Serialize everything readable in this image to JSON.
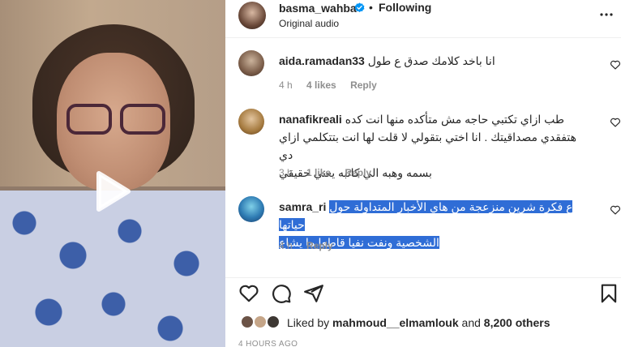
{
  "post": {
    "username": "basma_wahba",
    "separator": "•",
    "follow_label": "Following",
    "audio": "Original audio",
    "timestamp": "4 HOURS AGO"
  },
  "comments": [
    {
      "user": "aida.ramadan33",
      "text": "انا باخد كلامك صدق ع طول",
      "time": "4 h",
      "likes": "4 likes",
      "reply": "Reply"
    },
    {
      "user": "nanafikreali",
      "lines": [
        "طب ازاي تكتبي حاجه مش متأكده منها انت كده",
        "هتفقدي مصداقيتك . انا اختي بتقولي لا قلت لها انت بتتكلمي ازاي دي",
        "بسمه وهبه الي كاتبه يعني حقيقي"
      ],
      "time": "3 h",
      "likes": "1 like",
      "reply": "Reply"
    },
    {
      "user": "samra_ri",
      "lines": [
        "ع فكرة شرين منزعجة من هاي الأخبار المتداولة حول حياتها",
        "الشخصية ونفت نفيا قاطعا ما يشاع"
      ],
      "time": "4 h",
      "reply": "Reply"
    }
  ],
  "liked_by": {
    "prefix": "Liked by",
    "user": "mahmoud__elmamlouk",
    "and": "and",
    "others": "8,200 others"
  },
  "icons": {
    "verified": "verified-badge-icon",
    "more": "more-options-icon",
    "heart": "heart-icon",
    "comment": "comment-icon",
    "share": "share-icon",
    "save": "bookmark-icon",
    "play": "play-icon"
  },
  "colors": {
    "verified_blue": "#0095f6",
    "selection": "#2f6dd6",
    "muted_text": "#8e8e8e"
  }
}
